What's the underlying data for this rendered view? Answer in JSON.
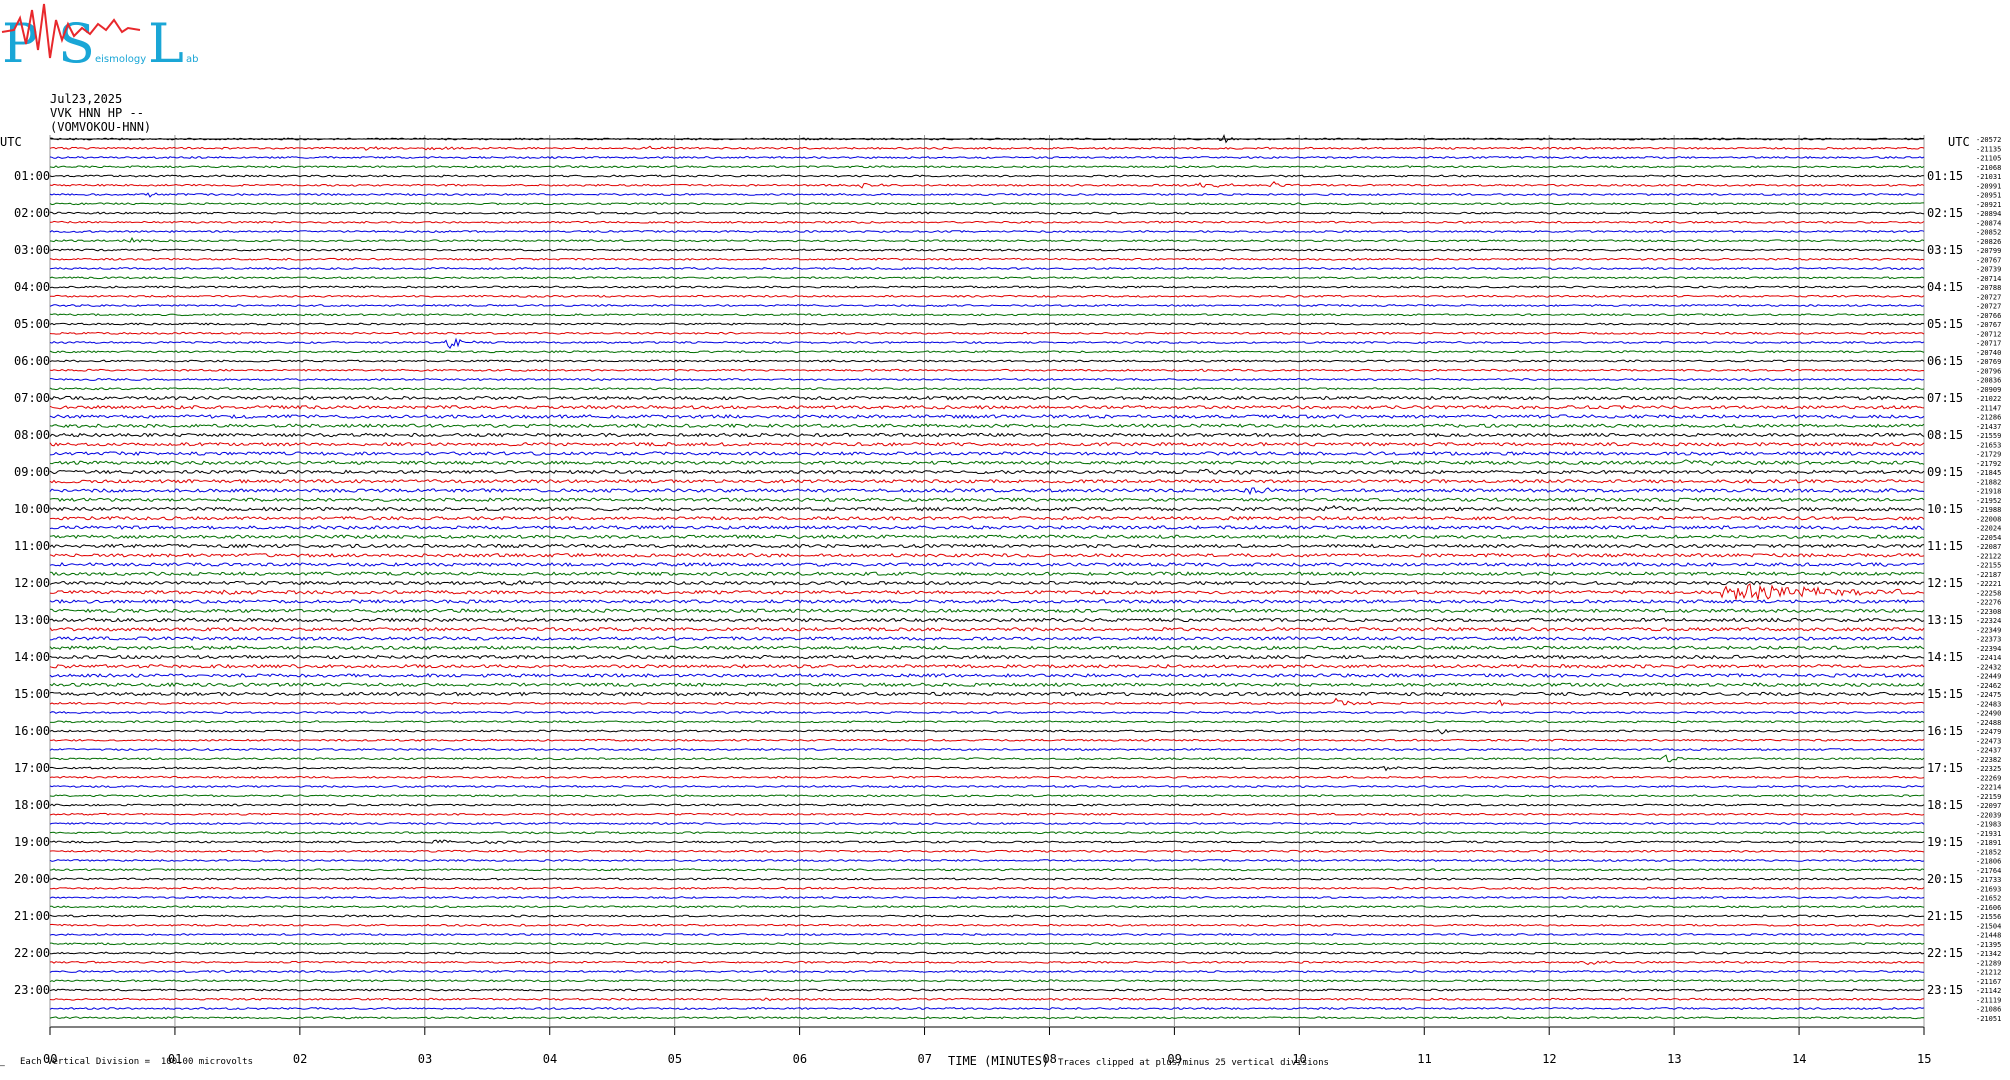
{
  "logo": {
    "letters": [
      "P",
      "S",
      "L"
    ],
    "small_words": [
      "eismology",
      "ab"
    ],
    "colors": {
      "letters": "#1aa6d6",
      "wave": "#e8282c"
    }
  },
  "header": {
    "date": "Jul23,2025",
    "station": "VVK HNN HP --",
    "location": "(VOMVOKOU-HNN)"
  },
  "left_axis": {
    "title": "UTC",
    "labels": [
      "01:00",
      "02:00",
      "03:00",
      "04:00",
      "05:00",
      "06:00",
      "07:00",
      "08:00",
      "09:00",
      "10:00",
      "11:00",
      "12:00",
      "13:00",
      "14:00",
      "15:00",
      "16:00",
      "17:00",
      "18:00",
      "19:00",
      "20:00",
      "21:00",
      "22:00",
      "23:00"
    ]
  },
  "right_axis": {
    "title": "UTC",
    "labels": [
      "01:15",
      "02:15",
      "03:15",
      "04:15",
      "05:15",
      "06:15",
      "07:15",
      "08:15",
      "09:15",
      "10:15",
      "11:15",
      "12:15",
      "13:15",
      "14:15",
      "15:15",
      "16:15",
      "17:15",
      "18:15",
      "19:15",
      "20:15",
      "21:15",
      "22:15",
      "23:15"
    ]
  },
  "bottom": {
    "left_note": "Each Vertical Division =  100.00 microvolts",
    "corner_mark": "—",
    "xlabel": "TIME (MINUTES)",
    "clip_note": "Traces clipped at plus/minus 25 vertical divisions"
  },
  "chart_data": {
    "type": "line",
    "title": "",
    "xlabel": "TIME (MINUTES)",
    "x_ticks": [
      "00",
      "01",
      "02",
      "03",
      "04",
      "05",
      "06",
      "07",
      "08",
      "09",
      "10",
      "11",
      "12",
      "13",
      "14",
      "15"
    ],
    "xlim": [
      0,
      15
    ],
    "rows": 96,
    "row_minutes": 15,
    "grid": true,
    "trace_colors": [
      "#000000",
      "#e00000",
      "#0000e0",
      "#006e00"
    ],
    "row_offsets": [
      "-20572",
      "-21135",
      "-21105",
      "-21068",
      "-21031",
      "-20991",
      "-20951",
      "-20921",
      "-20894",
      "-20874",
      "-20852",
      "-20826",
      "-20799",
      "-20767",
      "-20739",
      "-20714",
      "-20788",
      "-20727",
      "-20727",
      "-20766",
      "-20767",
      "-20712",
      "-20717",
      "-20740",
      "-20769",
      "-20796",
      "-20836",
      "-20909",
      "-21022",
      "-21147",
      "-21286",
      "-21437",
      "-21559",
      "-21653",
      "-21729",
      "-21792",
      "-21845",
      "-21882",
      "-21918",
      "-21952",
      "-21988",
      "-22008",
      "-22024",
      "-22054",
      "-22087",
      "-22122",
      "-22155",
      "-22187",
      "-22221",
      "-22258",
      "-22276",
      "-22308",
      "-22324",
      "-22349",
      "-22373",
      "-22394",
      "-22414",
      "-22432",
      "-22449",
      "-22462",
      "-22475",
      "-22483",
      "-22490",
      "-22488",
      "-22479",
      "-22473",
      "-22437",
      "-22382",
      "-22325",
      "-22269",
      "-22214",
      "-22159",
      "-22097",
      "-22039",
      "-21983",
      "-21931",
      "-21891",
      "-21852",
      "-21806",
      "-21764",
      "-21733",
      "-21693",
      "-21652",
      "-21606",
      "-21556",
      "-21504",
      "-21448",
      "-21395",
      "-21342",
      "-21289",
      "-21212",
      "-21167",
      "-21142",
      "-21119",
      "-21086",
      "-21051"
    ],
    "events": [
      {
        "row": 0,
        "minute": 9.4,
        "amplitude": 6,
        "duration": 0.1
      },
      {
        "row": 1,
        "minute": 2.5,
        "amplitude": 2.5,
        "duration": 0.4
      },
      {
        "row": 1,
        "minute": 3.0,
        "amplitude": 2.5,
        "duration": 0.3
      },
      {
        "row": 1,
        "minute": 4.8,
        "amplitude": 2,
        "duration": 0.3
      },
      {
        "row": 5,
        "minute": 6.5,
        "amplitude": 3,
        "duration": 0.3
      },
      {
        "row": 5,
        "minute": 9.2,
        "amplitude": 2.5,
        "duration": 0.5
      },
      {
        "row": 5,
        "minute": 9.8,
        "amplitude": 3,
        "duration": 0.3
      },
      {
        "row": 6,
        "minute": 0.8,
        "amplitude": 2.5,
        "duration": 0.2
      },
      {
        "row": 11,
        "minute": 0.6,
        "amplitude": 3,
        "duration": 0.3
      },
      {
        "row": 22,
        "minute": 3.2,
        "amplitude": 9,
        "duration": 0.2
      },
      {
        "row": 25,
        "minute": 9.0,
        "amplitude": 2,
        "duration": 0.5
      },
      {
        "row": 35,
        "minute": 13.1,
        "amplitude": 3,
        "duration": 0.6
      },
      {
        "row": 36,
        "minute": 9.2,
        "amplitude": 3,
        "duration": 0.5
      },
      {
        "row": 38,
        "minute": 9.6,
        "amplitude": 3,
        "duration": 0.5
      },
      {
        "row": 40,
        "minute": 10.2,
        "amplitude": 4,
        "duration": 0.3
      },
      {
        "row": 48,
        "minute": 3.7,
        "amplitude": 3,
        "duration": 0.2
      },
      {
        "row": 49,
        "minute": 1.4,
        "amplitude": 3,
        "duration": 0.3
      },
      {
        "row": 49,
        "minute": 13.4,
        "amplitude": 9,
        "duration": 2.2
      },
      {
        "row": 61,
        "minute": 10.3,
        "amplitude": 5,
        "duration": 0.3
      },
      {
        "row": 61,
        "minute": 11.6,
        "amplitude": 2.5,
        "duration": 0.3
      },
      {
        "row": 64,
        "minute": 11.15,
        "amplitude": 3,
        "duration": 0.1
      },
      {
        "row": 67,
        "minute": 12.95,
        "amplitude": 6,
        "duration": 0.15
      },
      {
        "row": 68,
        "minute": 10.7,
        "amplitude": 3,
        "duration": 0.1
      },
      {
        "row": 76,
        "minute": 3.0,
        "amplitude": 2,
        "duration": 1.5
      },
      {
        "row": 89,
        "minute": 12.3,
        "amplitude": 2.5,
        "duration": 0.2
      },
      {
        "row": 93,
        "minute": 5.7,
        "amplitude": 2.5,
        "duration": 0.2
      }
    ]
  }
}
